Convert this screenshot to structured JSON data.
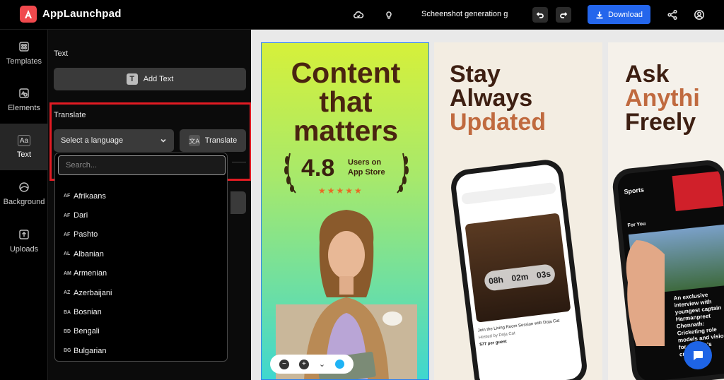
{
  "header": {
    "app_name": "AppLaunchpad",
    "document_name": "Scheenshot generation gu",
    "download_label": "Download"
  },
  "rail": {
    "items": [
      {
        "label": "Templates",
        "icon": "templates-icon"
      },
      {
        "label": "Elements",
        "icon": "elements-icon"
      },
      {
        "label": "Text",
        "icon": "text-icon"
      },
      {
        "label": "Background",
        "icon": "background-icon"
      },
      {
        "label": "Uploads",
        "icon": "uploads-icon"
      }
    ],
    "active": "Text"
  },
  "panel": {
    "text_section_label": "Text",
    "add_text_label": "Add Text",
    "translate_section_label": "Translate",
    "language_select_value": "Select a language",
    "translate_button_label": "Translate",
    "text_glyph": "T",
    "aa_glyph": "Aa"
  },
  "dropdown": {
    "search_placeholder": "Search...",
    "languages": [
      {
        "code": "AF",
        "name": "Afrikaans"
      },
      {
        "code": "AF",
        "name": "Dari"
      },
      {
        "code": "AF",
        "name": "Pashto"
      },
      {
        "code": "AL",
        "name": "Albanian"
      },
      {
        "code": "AM",
        "name": "Armenian"
      },
      {
        "code": "AZ",
        "name": "Azerbaijani"
      },
      {
        "code": "BA",
        "name": "Bosnian"
      },
      {
        "code": "BD",
        "name": "Bengali"
      },
      {
        "code": "BG",
        "name": "Bulgarian"
      }
    ]
  },
  "canvas": {
    "card1": {
      "headline_line1": "Content",
      "headline_line2": "that",
      "headline_line3": "matters",
      "rating_value": "4.8",
      "rating_label_line1": "Users on",
      "rating_label_line2": "App Store",
      "stars": "★★★★★"
    },
    "card2": {
      "headline_line1": "Stay",
      "headline_line2": "Always",
      "headline_line3": "Updated",
      "timer_hours": "08h",
      "timer_minutes": "02m",
      "timer_seconds": "03s",
      "event_line1": "Join the Living Room Session with Doja Cat",
      "event_line2": "Hosted by Doja Cat",
      "event_price": "$77 per guest"
    },
    "card3": {
      "headline_line1": "Ask",
      "headline_line2": "Anythi",
      "headline_line3": "Freely",
      "sports_label": "Sports",
      "for_you_label": "For You",
      "news_text": "An exclusive interview with youngest captain Harmanpreet Chennath: Cricketing role models and vision for women's cricket"
    }
  },
  "colors": {
    "accent_blue": "#2466ec",
    "highlight_red": "#e21b23",
    "brand_red": "#f0494d"
  }
}
